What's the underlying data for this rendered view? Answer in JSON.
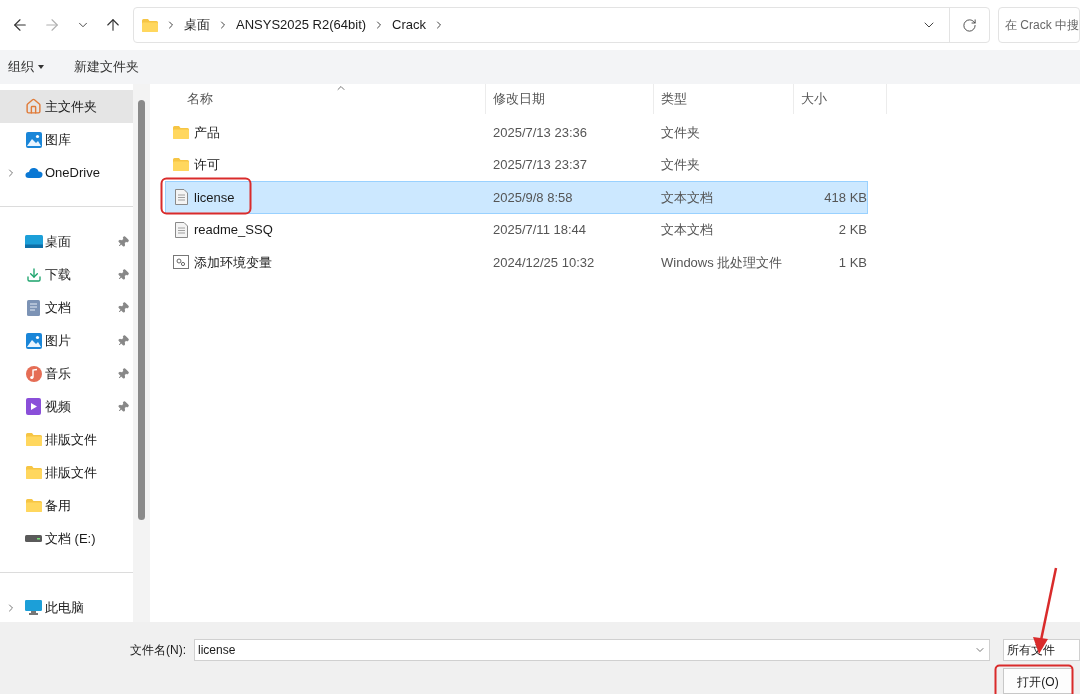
{
  "nav": {
    "back": {
      "disabled": false
    },
    "forward": {
      "disabled": true
    }
  },
  "address": {
    "breadcrumbs": [
      "桌面",
      "ANSYS2025 R2(64bit)",
      "Crack"
    ]
  },
  "search": {
    "placeholder": "在 Crack 中搜"
  },
  "toolbar": {
    "organize": "组织",
    "new_folder": "新建文件夹"
  },
  "sidebar": {
    "groups": [
      [
        {
          "label": "主文件夹",
          "kind": "home",
          "pinned": false,
          "expandable": false,
          "selected": true
        },
        {
          "label": "图库",
          "kind": "gallery",
          "pinned": false,
          "expandable": false,
          "selected": false
        },
        {
          "label": "OneDrive",
          "kind": "cloud",
          "pinned": false,
          "expandable": true,
          "selected": false
        }
      ],
      [
        {
          "label": "桌面",
          "kind": "desktop",
          "pinned": true,
          "expandable": false,
          "selected": false
        },
        {
          "label": "下载",
          "kind": "download",
          "pinned": true,
          "expandable": false,
          "selected": false
        },
        {
          "label": "文档",
          "kind": "document",
          "pinned": true,
          "expandable": false,
          "selected": false
        },
        {
          "label": "图片",
          "kind": "pictures",
          "pinned": true,
          "expandable": false,
          "selected": false
        },
        {
          "label": "音乐",
          "kind": "music",
          "pinned": true,
          "expandable": false,
          "selected": false
        },
        {
          "label": "视频",
          "kind": "video",
          "pinned": true,
          "expandable": false,
          "selected": false
        },
        {
          "label": "排版文件",
          "kind": "folder",
          "pinned": false,
          "expandable": false,
          "selected": false
        },
        {
          "label": "排版文件",
          "kind": "folder",
          "pinned": false,
          "expandable": false,
          "selected": false
        },
        {
          "label": "备用",
          "kind": "folder",
          "pinned": false,
          "expandable": false,
          "selected": false
        },
        {
          "label": "文档 (E:)",
          "kind": "drive",
          "pinned": false,
          "expandable": false,
          "selected": false
        }
      ],
      [
        {
          "label": "此电脑",
          "kind": "computer",
          "pinned": false,
          "expandable": true,
          "selected": false
        }
      ]
    ]
  },
  "table": {
    "columns": [
      "名称",
      "修改日期",
      "类型",
      "大小"
    ],
    "rows": [
      {
        "name": "产品",
        "kind": "folder",
        "modified": "2025/7/13 23:36",
        "type": "文件夹",
        "selected": false
      },
      {
        "name": "许可",
        "kind": "folder",
        "modified": "2025/7/13 23:37",
        "type": "文件夹",
        "selected": false
      },
      {
        "name": "license",
        "kind": "text",
        "modified": "2025/9/8 8:58",
        "type": "文本文档",
        "size": "418 KB",
        "selected": true
      },
      {
        "name": "readme_SSQ",
        "kind": "text",
        "modified": "2025/7/11 18:44",
        "type": "文本文档",
        "size": "2 KB",
        "selected": false
      },
      {
        "name": "添加环境变量",
        "kind": "batch",
        "modified": "2024/12/25 10:32",
        "type": "Windows 批处理文件",
        "size": "1 KB",
        "selected": false
      }
    ]
  },
  "footer": {
    "filename_label": "文件名(N):",
    "filename": "license",
    "filter": "所有文件",
    "open_button": "打开(O)"
  }
}
